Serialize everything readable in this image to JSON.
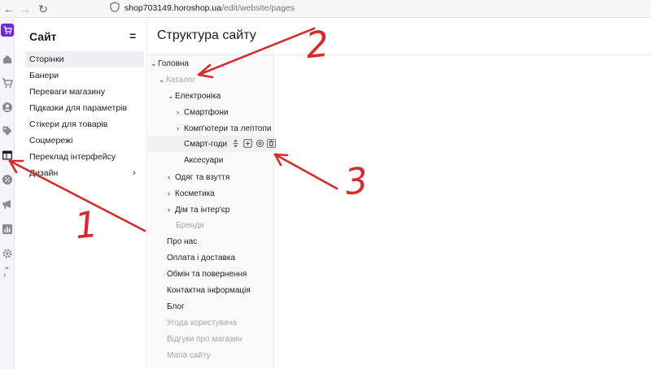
{
  "browser": {
    "url_host": "shop703149.horoshop.ua",
    "url_path": "/edit/website/pages"
  },
  "sidebar": {
    "title": "Сайт",
    "items": [
      {
        "label": "Сторінки"
      },
      {
        "label": "Банери"
      },
      {
        "label": "Переваги магазину"
      },
      {
        "label": "Підказки для параметрів"
      },
      {
        "label": "Стікери для товарів"
      },
      {
        "label": "Соцмережі"
      },
      {
        "label": "Переклад інтерфейсу"
      },
      {
        "label": "Дизайн"
      }
    ]
  },
  "main": {
    "title": "Структура сайту",
    "tree": [
      {
        "label": "Головна"
      },
      {
        "label": "Каталог"
      },
      {
        "label": "Електроніка"
      },
      {
        "label": "Смартфони"
      },
      {
        "label": "Комп'ютери та лептопи"
      },
      {
        "label": "Смарт-годи"
      },
      {
        "label": "Аксесуари"
      },
      {
        "label": "Одяг та взуття"
      },
      {
        "label": "Косметика"
      },
      {
        "label": "Дім та інтер'єр"
      },
      {
        "label": "Бренди"
      },
      {
        "label": "Про нас"
      },
      {
        "label": "Оплата і доставка"
      },
      {
        "label": "Обмін та повернення"
      },
      {
        "label": "Контактна інформація"
      },
      {
        "label": "Блог"
      },
      {
        "label": "Угода користувача"
      },
      {
        "label": "Відгуки про магазин"
      },
      {
        "label": "Мапа сайту"
      }
    ]
  },
  "annotations": [
    "1",
    "2",
    "3"
  ],
  "colors": {
    "brand": "#6e28d9",
    "annotation": "#d72a2a",
    "muted_text": "#a6a6ad"
  }
}
